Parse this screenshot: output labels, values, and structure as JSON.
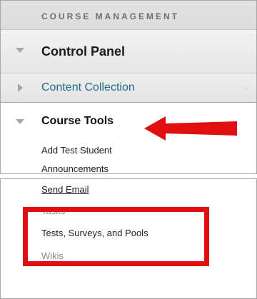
{
  "header": {
    "title": "COURSE MANAGEMENT"
  },
  "control_panel": {
    "label": "Control Panel"
  },
  "content_collection": {
    "label": "Content Collection",
    "chevron": "›"
  },
  "course_tools": {
    "label": "Course Tools",
    "items": [
      "Add Test Student",
      "Announcements"
    ]
  },
  "lower_list": {
    "items": [
      "Send Email",
      "Tasks",
      "Tests, Surveys, and Pools",
      "Wikis"
    ]
  },
  "annotation": {
    "color": "#e01010"
  }
}
